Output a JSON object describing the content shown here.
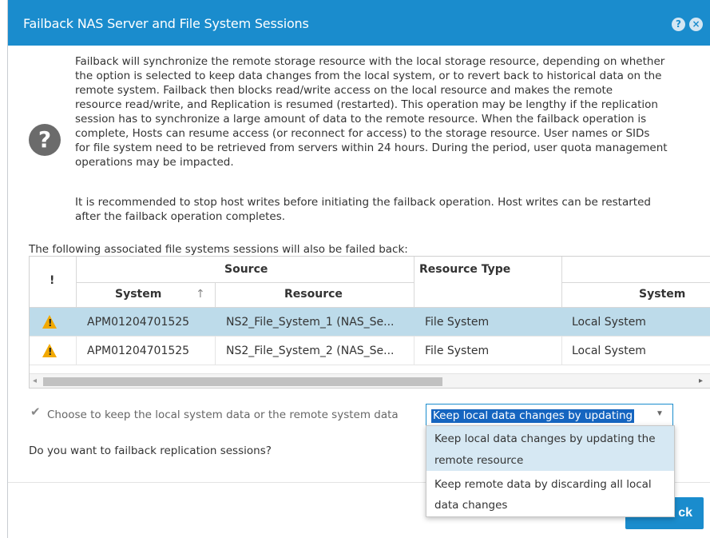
{
  "dialog": {
    "title": "Failback NAS Server and File System Sessions",
    "help_glyph": "?",
    "close_glyph": "×"
  },
  "message": {
    "icon_glyph": "?",
    "lines1": [
      "Failback will synchronize the remote storage resource with the local storage resource, depending on whether",
      "the option is selected to keep data changes from the local system, or to revert back to historical data on the",
      "remote system. Failback then blocks read/write access on the local resource and makes the remote",
      "resource read/write, and Replication is resumed (restarted). This operation may be lengthy if the replication",
      "session has to synchronize a large amount of data to the remote resource. When the failback operation is",
      "complete, Hosts can resume access (or reconnect for access) to the storage resource. User names or SIDs",
      "for file system need to be retrieved from servers within 24 hours. During the period, user quota management",
      "operations may be impacted."
    ],
    "lines2": [
      "It is recommended to stop host writes before initiating the failback operation. Host writes can be restarted",
      "after the failback operation completes."
    ]
  },
  "sessions": {
    "label": "The following associated file systems sessions will also be failed back:",
    "headers": {
      "alert": "!",
      "source_group": "Source",
      "system": "System",
      "sort_glyph": "↑",
      "resource": "Resource",
      "resource_type": "Resource Type",
      "dest_system": "System"
    },
    "rows": [
      {
        "alert": "!",
        "system": "APM01204701525",
        "resource": "NS2_File_System_1 (NAS_Se...",
        "resource_type": "File System",
        "dest_system": "Local System",
        "selected": true
      },
      {
        "alert": "!",
        "system": "APM01204701525",
        "resource": "NS2_File_System_2 (NAS_Se...",
        "resource_type": "File System",
        "dest_system": "Local System",
        "selected": false
      }
    ],
    "scroll_left": "◂",
    "scroll_right": "▸"
  },
  "option": {
    "checkbox_glyph": "✔",
    "checked": true,
    "label": "Choose to keep the local system data or the remote system data",
    "selected_value": "Keep local data changes by updating",
    "arrow": "▼",
    "options": [
      {
        "line1": "Keep local data changes by updating the",
        "line2": "remote resource"
      },
      {
        "line1": "Keep remote data by discarding all local",
        "line2": "data changes"
      }
    ]
  },
  "question": "Do you want to failback replication sessions?",
  "footer": {
    "failback_label": "ck"
  },
  "colors": {
    "accent": "#1a8ccd",
    "row_selected": "#bddbea",
    "warning": "#f2a900"
  }
}
